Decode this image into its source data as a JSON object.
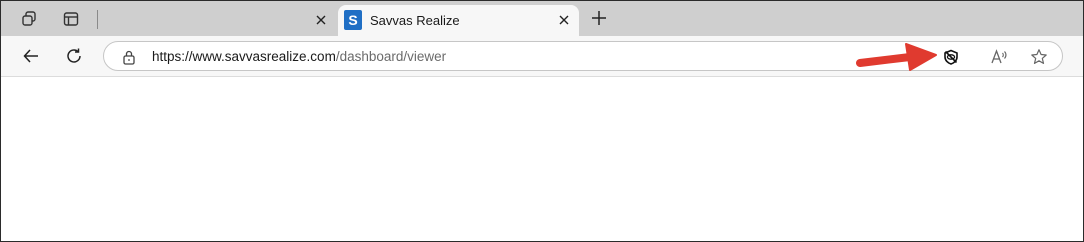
{
  "tabs": [
    {
      "title": "",
      "active": false
    },
    {
      "title": "Savvas Realize",
      "active": true,
      "favicon_letter": "S"
    }
  ],
  "address": {
    "url_domain": "https://www.savvasrealize.com",
    "url_path": "/dashboard/viewer"
  },
  "icons": {
    "workspaces": "workspaces-icon",
    "tab_actions": "tab-actions-icon",
    "close": "close-icon",
    "new_tab": "plus-icon",
    "back": "back-arrow-icon",
    "refresh": "refresh-icon",
    "lock": "lock-icon",
    "tracking_prevention": "tracking-prevention-icon",
    "read_aloud": "read-aloud-icon",
    "favorites": "star-icon"
  },
  "colors": {
    "tabstrip_bg": "#cfcfcf",
    "active_tab_bg": "#f7f7f7",
    "favicon_bg": "#1f6fc5",
    "annotation_arrow": "#e03a2f"
  }
}
